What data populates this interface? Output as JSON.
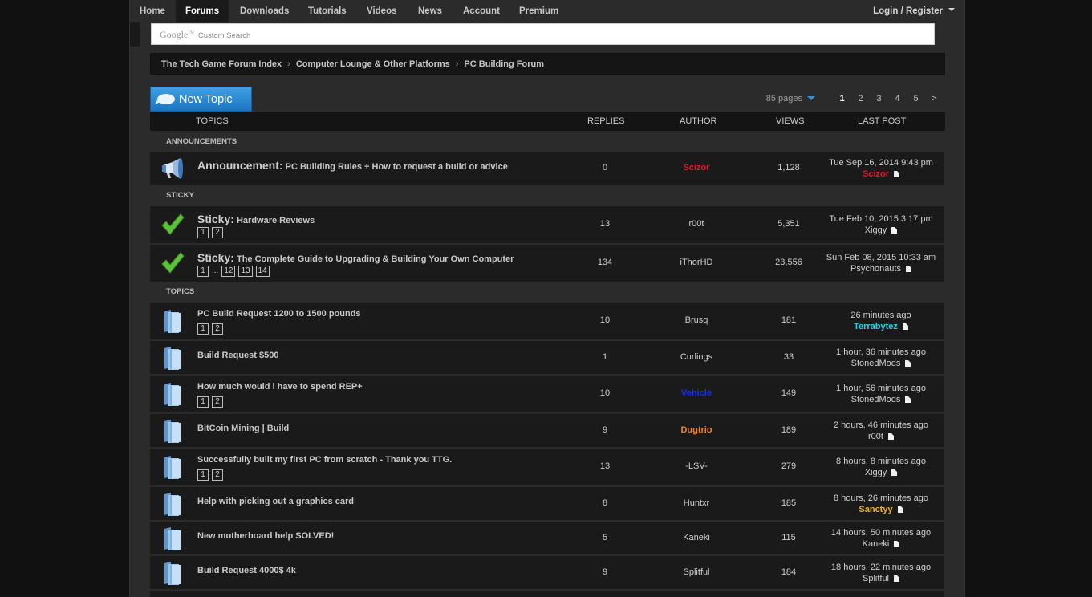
{
  "nav": {
    "items": [
      "Home",
      "Forums",
      "Downloads",
      "Tutorials",
      "Videos",
      "News",
      "Account",
      "Premium"
    ],
    "active": "Forums",
    "login_label": "Login / Register"
  },
  "search": {
    "brand": "Google",
    "brand_tm": "TM",
    "placeholder": "Custom Search"
  },
  "breadcrumb": [
    "The Tech Game Forum Index",
    "Computer Lounge & Other Platforms",
    "PC Building Forum"
  ],
  "new_topic_label": "New Topic",
  "pagination": {
    "pages_count": "85 pages",
    "pages": [
      "1",
      "2",
      "3",
      "4",
      "5"
    ],
    "current": "1",
    "next": ">"
  },
  "columns": {
    "topics": "TOPICS",
    "replies": "REPLIES",
    "author": "AUTHOR",
    "views": "VIEWS",
    "last_post": "LAST POST"
  },
  "sections": {
    "announcements": "ANNOUNCEMENTS",
    "sticky": "STICKY",
    "topics": "TOPICS"
  },
  "colors": {
    "admin_red": "#e3182b",
    "cyan": "#22d6ee",
    "blue": "#1530ff",
    "orange": "#f0812a",
    "gold": "#e8b02a",
    "default_user": "#cfcfcf",
    "accent_blue": "#2a86d4"
  },
  "announcements": [
    {
      "icon": "megaphone-icon",
      "prefix": "Announcement:",
      "title": "PC Building Rules + How to request a build or advice",
      "pages": [],
      "replies": "0",
      "author": "Scizor",
      "author_color": "#e3182b",
      "views": "1,128",
      "last_time": "Tue Sep 16, 2014 9:43 pm",
      "last_user": "Scizor",
      "last_color": "#e3182b"
    }
  ],
  "sticky": [
    {
      "icon": "checkmark-icon",
      "prefix": "Sticky:",
      "title": "Hardware Reviews",
      "pages": [
        "1",
        "2"
      ],
      "replies": "13",
      "author": "r00t",
      "author_color": "#cfcfcf",
      "views": "5,351",
      "last_time": "Tue Feb 10, 2015 3:17 pm",
      "last_user": "Xiggy",
      "last_color": "#cfcfcf"
    },
    {
      "icon": "checkmark-icon",
      "prefix": "Sticky:",
      "title": "The Complete Guide to Upgrading & Building Your Own Computer",
      "pages": [
        "1",
        "...",
        "12",
        "13",
        "14"
      ],
      "replies": "134",
      "author": "iThorHD",
      "author_color": "#cfcfcf",
      "views": "23,556",
      "last_time": "Sun Feb 08, 2015 10:33 am",
      "last_user": "Psychonauts",
      "last_color": "#cfcfcf"
    }
  ],
  "topics": [
    {
      "title": "PC Build Request 1200 to 1500 pounds",
      "pages": [
        "1",
        "2"
      ],
      "replies": "10",
      "author": "Brusq",
      "author_color": "#cfcfcf",
      "views": "181",
      "last_time": "26 minutes ago",
      "last_user": "Terrabytez",
      "last_color": "#22d6ee"
    },
    {
      "title": "Build Request $500",
      "pages": [],
      "replies": "1",
      "author": "Curlings",
      "author_color": "#cfcfcf",
      "views": "33",
      "last_time": "1 hour, 36 minutes ago",
      "last_user": "StonedMods",
      "last_color": "#cfcfcf"
    },
    {
      "title": "How much would i have to spend REP+",
      "pages": [
        "1",
        "2"
      ],
      "replies": "10",
      "author": "Vehicle",
      "author_color": "#1530ff",
      "views": "149",
      "last_time": "1 hour, 56 minutes ago",
      "last_user": "StonedMods",
      "last_color": "#cfcfcf"
    },
    {
      "title": "BitCoin Mining | Build",
      "pages": [],
      "replies": "9",
      "author": "Dugtrio",
      "author_color": "#f0812a",
      "views": "189",
      "last_time": "2 hours, 46 minutes ago",
      "last_user": "r00t",
      "last_color": "#cfcfcf"
    },
    {
      "title": "Successfully built my first PC from scratch - Thank you TTG.",
      "pages": [
        "1",
        "2"
      ],
      "replies": "13",
      "author": "-LSV-",
      "author_color": "#cfcfcf",
      "views": "279",
      "last_time": "8 hours, 8 minutes ago",
      "last_user": "Xiggy",
      "last_color": "#cfcfcf"
    },
    {
      "title": "Help with picking out a graphics card",
      "pages": [],
      "replies": "8",
      "author": "Huntxr",
      "author_color": "#cfcfcf",
      "views": "185",
      "last_time": "8 hours, 26 minutes ago",
      "last_user": "Sanctyy",
      "last_color": "#e8b02a"
    },
    {
      "title": "New motherboard help SOLVED!",
      "pages": [],
      "replies": "5",
      "author": "Kaneki",
      "author_color": "#cfcfcf",
      "views": "115",
      "last_time": "14 hours, 50 minutes ago",
      "last_user": "Kaneki",
      "last_color": "#cfcfcf"
    },
    {
      "title": "Build Request 4000$ 4k",
      "pages": [],
      "replies": "9",
      "author": "Splitful",
      "author_color": "#cfcfcf",
      "views": "184",
      "last_time": "18 hours, 22 minutes ago",
      "last_user": "Splitful",
      "last_color": "#cfcfcf"
    }
  ]
}
